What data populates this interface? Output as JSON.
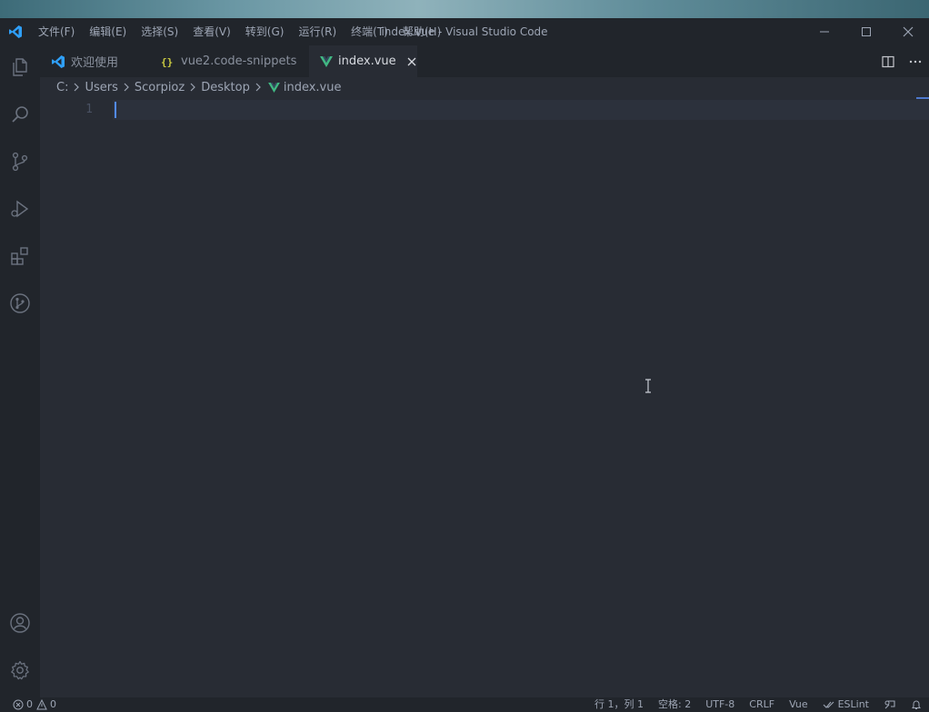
{
  "window": {
    "title": "index.vue - Visual Studio Code"
  },
  "menu": [
    "文件(F)",
    "编辑(E)",
    "选择(S)",
    "查看(V)",
    "转到(G)",
    "运行(R)",
    "终端(T)",
    "帮助(H)"
  ],
  "tabs": [
    {
      "label": "欢迎使用",
      "icon": "vscode-logo-icon"
    },
    {
      "label": "vue2.code-snippets",
      "icon": "json-braces-icon"
    },
    {
      "label": "index.vue",
      "icon": "vue-logo-icon",
      "active": true
    }
  ],
  "breadcrumb": [
    "C:",
    "Users",
    "Scorpioz",
    "Desktop",
    "index.vue"
  ],
  "editor": {
    "line_numbers": [
      "1"
    ]
  },
  "activity_bar": [
    "files-icon",
    "search-icon",
    "source-control-icon",
    "run-debug-icon",
    "extensions-icon",
    "git-graph-icon",
    "account-icon",
    "settings-gear-icon"
  ],
  "status": {
    "errors": "0",
    "warnings": "0",
    "position": "行 1，列 1",
    "spaces": "空格: 2",
    "encoding": "UTF-8",
    "eol": "CRLF",
    "language": "Vue",
    "linter": "ESLint"
  },
  "colors": {
    "background": "#282c34",
    "chrome": "#21252b",
    "vue_green": "#41b883",
    "vscode_blue": "#2f9ff8",
    "cursor": "#528bff"
  }
}
